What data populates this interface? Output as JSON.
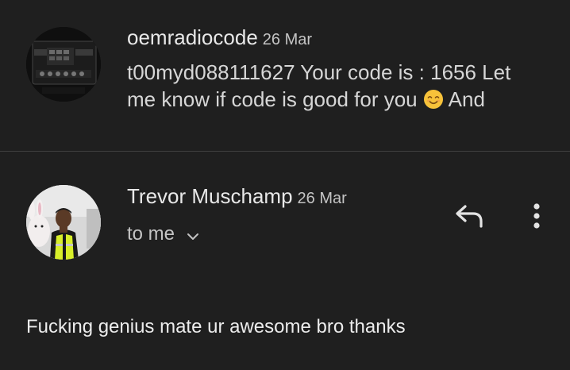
{
  "messages": [
    {
      "sender": "oemradiocode",
      "date": "26 Mar",
      "snippet_line1": "t00myd088111627 Your code is : 1656 Let",
      "snippet_line2": "me know if code is good for you",
      "snippet_tail": "And",
      "emoji": "smiling-face-emoji"
    },
    {
      "sender": "Trevor Muschamp",
      "date": "26 Mar",
      "recipient": "to me",
      "body": "Fucking genius mate ur awesome bro thanks"
    }
  ],
  "icons": {
    "reply": "reply-icon",
    "more": "more-vert-icon",
    "expand": "chevron-down-icon"
  },
  "colors": {
    "background": "#1f1f1f",
    "divider": "#3f3f3f",
    "primary_text": "#e3e3e3",
    "secondary_text": "#c4c4c4"
  }
}
